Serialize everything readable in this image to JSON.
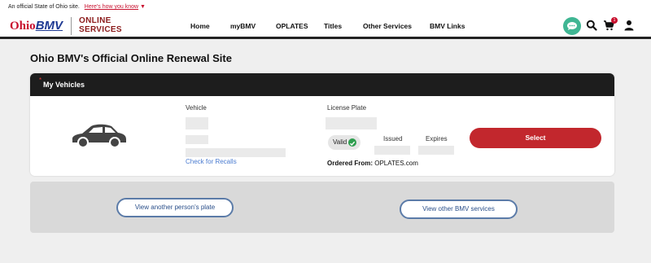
{
  "topbar": {
    "notice": "An official State of Ohio site.",
    "link": "Here's how you know"
  },
  "header": {
    "logo_ohio": "Ohio",
    "logo_bmv": "BMV",
    "logo_sub_line1": "ONLINE",
    "logo_sub_line2": "SERVICES",
    "nav": [
      "Home",
      "myBMV",
      "OPLATES",
      "Titles",
      "Other Services",
      "BMV Links"
    ],
    "cart_count": "1",
    "accent_color": "#c8102e"
  },
  "page": {
    "title": "Ohio BMV's Official Online Renewal Site"
  },
  "vehicle_card": {
    "title": "My Vehicles",
    "required_mark": "*",
    "vehicle_label": "Vehicle",
    "plate_label": "License Plate",
    "status": "Valid",
    "issued_label": "Issued",
    "expires_label": "Expires",
    "recalls_link": "Check for Recalls",
    "ordered_from_label": "Ordered From:",
    "ordered_from_value": "OPLATES.com",
    "select_button": "Select"
  },
  "actions": {
    "another_plate": "View another person's plate",
    "other_services": "View other BMV services"
  }
}
